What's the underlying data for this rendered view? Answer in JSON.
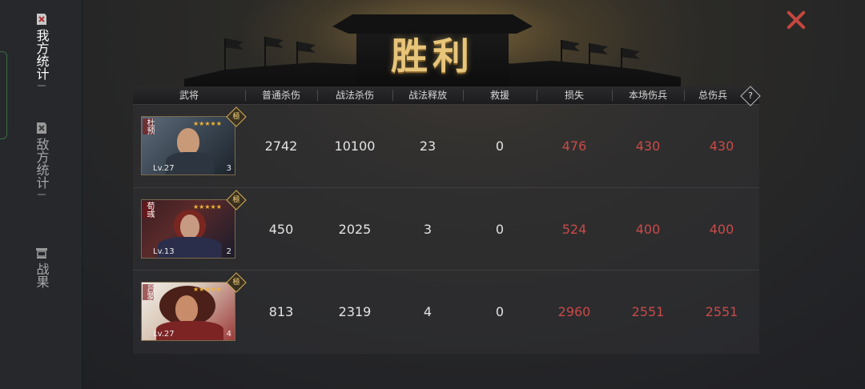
{
  "sidebar": {
    "items": [
      {
        "label": "我方统计",
        "icon": "shield-icon",
        "active": true
      },
      {
        "label": "敌方统计",
        "icon": "shield-icon",
        "active": false
      },
      {
        "label": "战果",
        "icon": "cart-icon",
        "active": false
      }
    ]
  },
  "banner": {
    "title": "胜利"
  },
  "table": {
    "headers": [
      "武将",
      "普通杀伤",
      "战法杀伤",
      "战法释放",
      "救援",
      "损失",
      "本场伤兵",
      "总伤兵"
    ],
    "help_label": "?",
    "rows": [
      {
        "name": "杜预",
        "level": "Lv.27",
        "count": "3",
        "stars": 5,
        "badge": "極",
        "normal_kill": "2742",
        "tactic_kill": "10100",
        "tactic_release": "23",
        "rescue": "0",
        "loss": "476",
        "wounded_this": "430",
        "wounded_total": "430"
      },
      {
        "name": "荀彧",
        "level": "Lv.13",
        "count": "2",
        "stars": 5,
        "badge": "極",
        "normal_kill": "450",
        "tactic_kill": "2025",
        "tactic_release": "3",
        "rescue": "0",
        "loss": "524",
        "wounded_this": "400",
        "wounded_total": "400"
      },
      {
        "name": "吕蒙",
        "level": "Lv.27",
        "count": "4",
        "stars": 5,
        "badge": "極",
        "normal_kill": "813",
        "tactic_kill": "2319",
        "tactic_release": "4",
        "rescue": "0",
        "loss": "2960",
        "wounded_this": "2551",
        "wounded_total": "2551"
      }
    ]
  },
  "colors": {
    "loss": "#c94a48",
    "accent": "#e7c57a",
    "close": "#c4473f"
  }
}
